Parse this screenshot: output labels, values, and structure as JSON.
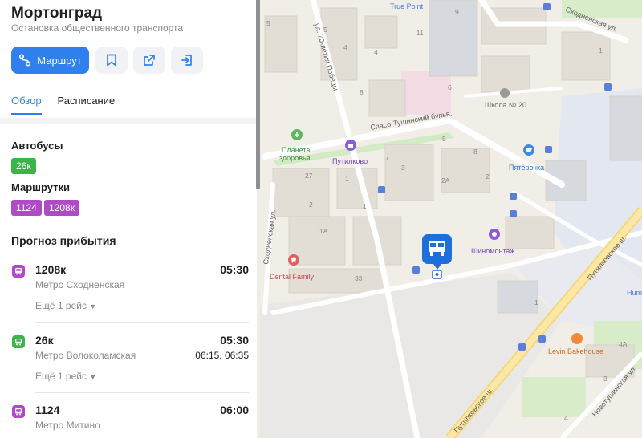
{
  "stop": {
    "title": "Мортонград",
    "subtitle": "Остановка общественного транспорта"
  },
  "actions": {
    "route_label": "Маршрут",
    "save_icon": "bookmark-icon",
    "share_icon": "share-icon",
    "enter_icon": "login-icon"
  },
  "tabs": [
    {
      "label": "Обзор",
      "active": true
    },
    {
      "label": "Расписание",
      "active": false
    }
  ],
  "buses": {
    "label": "Автобусы",
    "routes": [
      "26к"
    ],
    "color": "#3bb54a"
  },
  "minibuses": {
    "label": "Маршрутки",
    "routes": [
      "1124",
      "1208к"
    ],
    "color": "#b04ac7"
  },
  "forecast": {
    "title": "Прогноз прибытия",
    "items": [
      {
        "route": "1208к",
        "destination": "Метро Сходненская",
        "time": "05:30",
        "next": "",
        "more": "Ещё 1 рейс"
      },
      {
        "route": "26к",
        "destination": "Метро Волоколамская",
        "time": "05:30",
        "next": "06:15, 06:35",
        "more": "Ещё 1 рейс"
      },
      {
        "route": "1124",
        "destination": "Метро Митино",
        "time": "06:00",
        "next": "",
        "more": ""
      }
    ]
  },
  "map": {
    "labels": {
      "true_point": "True Point",
      "school": "Школа № 20",
      "planeta": "Планета",
      "planeta2": "здоровья",
      "putilkovo": "Путилково",
      "pyaterochka": "Пятёрочка",
      "shinomontazh": "Шиномонтаж",
      "dental": "Dental Family",
      "levin": "Levin Bakehouse",
      "hum": "Hum",
      "street_spaso": "Спасо-Тушинский бульв.",
      "street_70": "ул. 70-летия Победы",
      "street_shod_w": "Сходненская ул.",
      "street_shod_n": "Сходненская ул.",
      "street_putil_1": "Путилковское ш.",
      "street_putil_2": "Путилковское ш.",
      "street_novotush": "Новотушинская ул."
    },
    "house_numbers": [
      "5",
      "9",
      "11",
      "5",
      "4",
      "4",
      "8",
      "6",
      "1",
      "7",
      "5",
      "8",
      "2",
      "1",
      "3",
      "2А",
      "27",
      "1",
      "2",
      "1А",
      "33",
      "1",
      "1",
      "4А",
      "3",
      "4"
    ],
    "colors": {
      "stop_marker": "#1e6fd9",
      "poi_purple": "#8b5cd6",
      "poi_green": "#3bb54a",
      "poi_red": "#e45d5d",
      "poi_orange": "#f08a3c"
    }
  }
}
